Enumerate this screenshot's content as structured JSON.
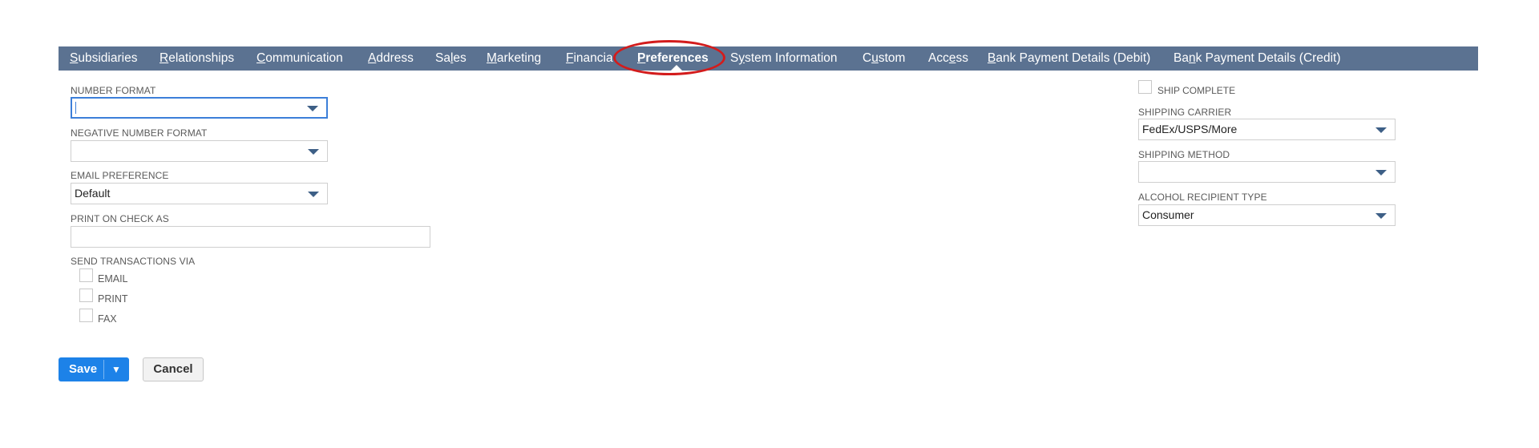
{
  "tabs": [
    {
      "prefix": "",
      "key": "S",
      "suffix": "ubsidiaries"
    },
    {
      "prefix": "",
      "key": "R",
      "suffix": "elationships"
    },
    {
      "prefix": "",
      "key": "C",
      "suffix": "ommunication"
    },
    {
      "prefix": "",
      "key": "A",
      "suffix": "ddress"
    },
    {
      "prefix": "Sa",
      "key": "l",
      "suffix": "es"
    },
    {
      "prefix": "",
      "key": "M",
      "suffix": "arketing"
    },
    {
      "prefix": "",
      "key": "F",
      "suffix": "inancia"
    },
    {
      "prefix": "",
      "key": "P",
      "suffix": "references"
    },
    {
      "prefix": "S",
      "key": "y",
      "suffix": "stem Information"
    },
    {
      "prefix": "C",
      "key": "u",
      "suffix": "stom"
    },
    {
      "prefix": "Acc",
      "key": "e",
      "suffix": "ss"
    },
    {
      "prefix": "",
      "key": "B",
      "suffix": "ank Payment Details (Debit)"
    },
    {
      "prefix": "Ba",
      "key": "n",
      "suffix": "k Payment Details (Credit)"
    }
  ],
  "active_tab": "Preferences",
  "left": {
    "number_format": {
      "label": "NUMBER FORMAT",
      "value": ""
    },
    "negative_number_format": {
      "label": "NEGATIVE NUMBER FORMAT",
      "value": ""
    },
    "email_preference": {
      "label": "EMAIL PREFERENCE",
      "value": "Default"
    },
    "print_on_check_as": {
      "label": "PRINT ON CHECK AS",
      "value": ""
    },
    "send_transactions_via": {
      "label": "SEND TRANSACTIONS VIA",
      "options": [
        "EMAIL",
        "PRINT",
        "FAX"
      ]
    }
  },
  "right": {
    "ship_complete": {
      "label": "SHIP COMPLETE"
    },
    "shipping_carrier": {
      "label": "SHIPPING CARRIER",
      "value": "FedEx/USPS/More"
    },
    "shipping_method": {
      "label": "SHIPPING METHOD",
      "value": ""
    },
    "alcohol_recipient_type": {
      "label": "ALCOHOL RECIPIENT TYPE",
      "value": "Consumer"
    }
  },
  "buttons": {
    "save": "Save",
    "save_menu": "▼",
    "cancel": "Cancel"
  },
  "colors": {
    "tabbar": "#5b7291",
    "save": "#1d82e8",
    "annotation": "#d31c1c",
    "focus": "#3c7fd9"
  }
}
